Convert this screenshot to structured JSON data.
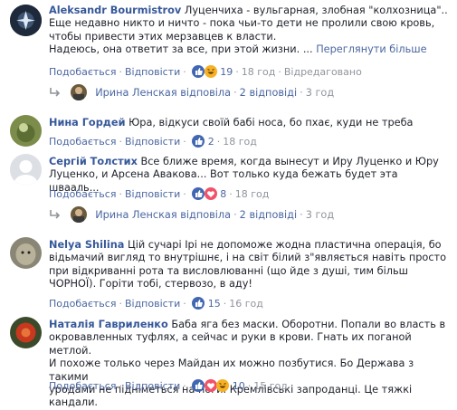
{
  "comments": [
    {
      "author": "Aleksandr Bourmistrov",
      "text_lines": [
        "Луценчиха - вульгарная, злобная \"колхозница\"..",
        "Еще недавно никто и ничто - пока чьи-то дети не пролили свою кровь,",
        "чтобы привести этих мерзавцев к власти.",
        "Надеюсь, она ответит за все, при этой жизни. ..."
      ],
      "see_more": "Переглянути більше",
      "like_label": "Подобається",
      "reply_label": "Відповісти",
      "reaction_count": "19",
      "time": "18 год",
      "edited": "Відредаговано"
    },
    {
      "author": "Нина Гордей",
      "text_lines": [
        "Юра, відкуси своїй бабі носа, бо пхає, куди не треба"
      ],
      "like_label": "Подобається",
      "reply_label": "Відповісти",
      "reaction_count": "2",
      "time": "18 год"
    },
    {
      "author": "Сергій Толстих",
      "text_lines": [
        "Все ближе время, когда вынесут и Иру Луценко и Юру",
        "Луценко, и Арсена Авакова... Вот только куда бежать будет эта швааль..."
      ],
      "like_label": "Подобається",
      "reply_label": "Відповісти",
      "reaction_count": "8",
      "time": "18 год"
    },
    {
      "author": "Nelya Shilina",
      "text_lines": [
        "Цій сучарі Ірі не допоможе жодна пластична операція, бо",
        "відьмачий вигляд то внутрішнє, і на світ білий з\"являється навіть просто",
        "при відкриванні рота та висловлюванні (що йде з душі, тим більш",
        "ЧОРНОЇ). Горіти тобі, стервозо, в аду!"
      ],
      "like_label": "Подобається",
      "reply_label": "Відповісти",
      "reaction_count": "15",
      "time": "16 год"
    },
    {
      "author": "Наталія Гавриленко",
      "text_lines": [
        "Баба яга без маски. Оборотни. Попали во власть в",
        "окровавленных туфлях, а сейчас и руки в крови. Гнать их поганой метлой.",
        "И похоже только через Майдан их можно позбутися. Бо Держава з такими",
        "уродами не підніметься на ноги. Кремлівські запроданці. Це тяжкі кандали."
      ],
      "like_label": "Подобається",
      "reply_label": "Відповісти",
      "reaction_count": "10",
      "time": "15 год"
    }
  ],
  "replies": [
    {
      "text": "Ирина Ленская відповіла",
      "count": "2 відповіді",
      "time": "3 год"
    },
    {
      "text": "Ирина Ленская відповіла",
      "count": "2 відповіді",
      "time": "3 год"
    }
  ],
  "icons": {
    "like_color": "#4267b2",
    "haha_color": "#f7b125",
    "love_color": "#f25268"
  }
}
